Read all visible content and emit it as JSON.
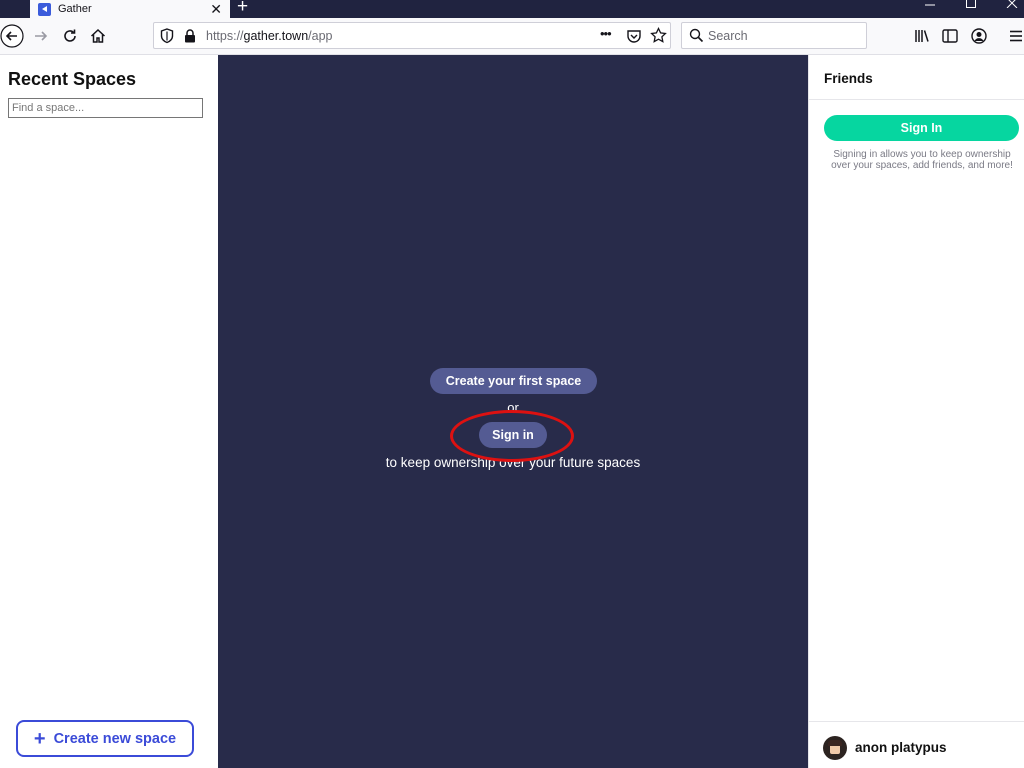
{
  "browser": {
    "tab_title": "Gather",
    "tab_close": "✕",
    "new_tab": "+",
    "url_scheme": "https://",
    "url_domain": "gather.town",
    "url_path": "/app",
    "search_placeholder": "Search",
    "page_actions": "•••",
    "window_controls": {
      "minimize": "–",
      "maximize": "☐",
      "close": "✕"
    }
  },
  "left_sidebar": {
    "title": "Recent Spaces",
    "search_placeholder": "Find a space...",
    "create_button_label": "Create new space",
    "create_button_icon": "+"
  },
  "main": {
    "create_first_label": "Create your first space",
    "or_label": "or",
    "sign_in_label": "Sign in",
    "keep_text": "to keep ownership over your future spaces",
    "highlight_color": "#dd1111"
  },
  "right_sidebar": {
    "title": "Friends",
    "sign_in_label": "Sign In",
    "note": "Signing in allows you to keep ownership over your spaces, add friends, and more!",
    "username": "anon platypus"
  },
  "colors": {
    "main_bg": "#282b4a",
    "pill_bg": "#545b93",
    "accent_green": "#06d6a0",
    "accent_blue": "#3b4bd8"
  }
}
